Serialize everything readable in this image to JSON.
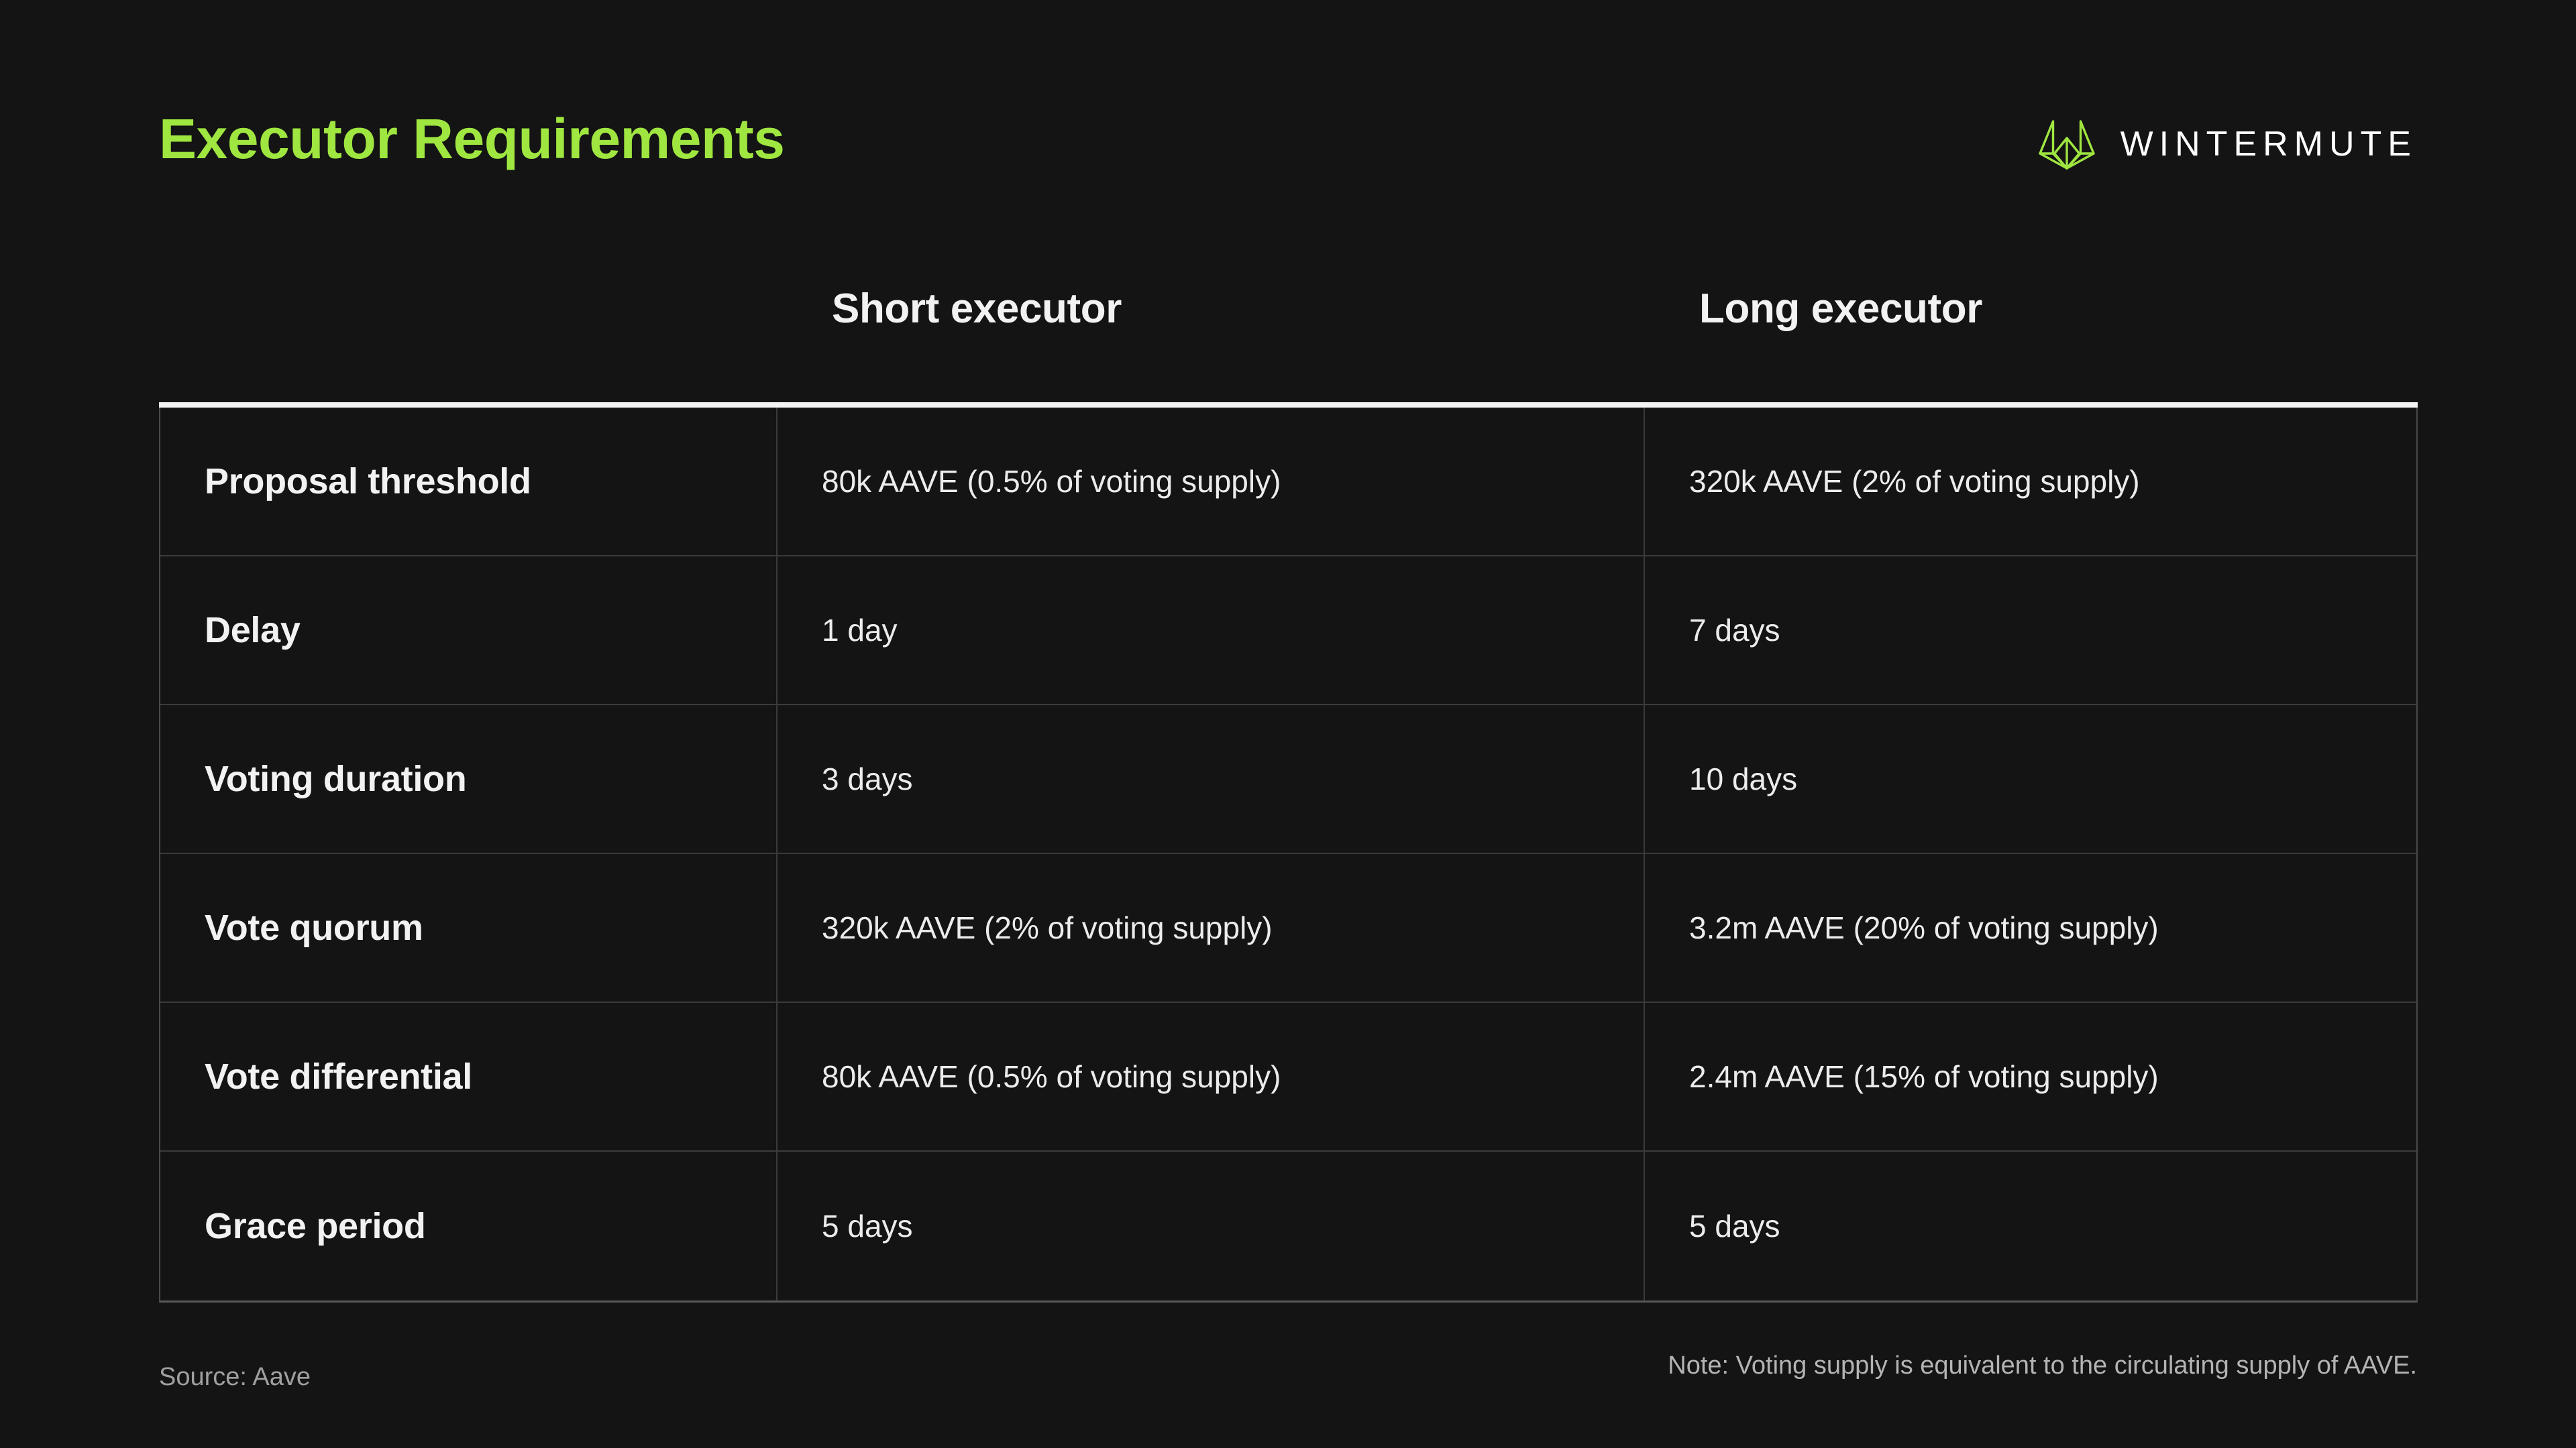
{
  "page": {
    "title": "Executor Requirements",
    "background_color": "#141414",
    "accent_color": "#9fe640"
  },
  "brand": {
    "mark_icon": "wintermute-logo-icon",
    "wordmark": "WINTERMUTE",
    "mark_color": "#9fe640",
    "wordmark_color": "#ffffff"
  },
  "table": {
    "row_header_label": "",
    "columns": [
      {
        "key": "metric",
        "label": ""
      },
      {
        "key": "short",
        "label": "Short executor"
      },
      {
        "key": "long",
        "label": "Long executor"
      }
    ],
    "rows": [
      {
        "metric": "Proposal threshold",
        "short": "80k AAVE (0.5% of voting supply)",
        "long": "320k AAVE (2% of voting supply)"
      },
      {
        "metric": "Delay",
        "short": "1 day",
        "long": "7 days"
      },
      {
        "metric": "Voting duration",
        "short": "3 days",
        "long": "10 days"
      },
      {
        "metric": "Vote quorum",
        "short": "320k AAVE (2% of voting supply)",
        "long": "3.2m AAVE (20% of voting supply)"
      },
      {
        "metric": "Vote differential",
        "short": "80k AAVE (0.5% of voting supply)",
        "long": "2.4m AAVE (15% of voting supply)"
      },
      {
        "metric": "Grace period",
        "short": "5 days",
        "long": "5 days"
      }
    ]
  },
  "footer": {
    "source": "Source: Aave",
    "note": "Note: Voting supply is equivalent to the circulating supply of AAVE."
  }
}
